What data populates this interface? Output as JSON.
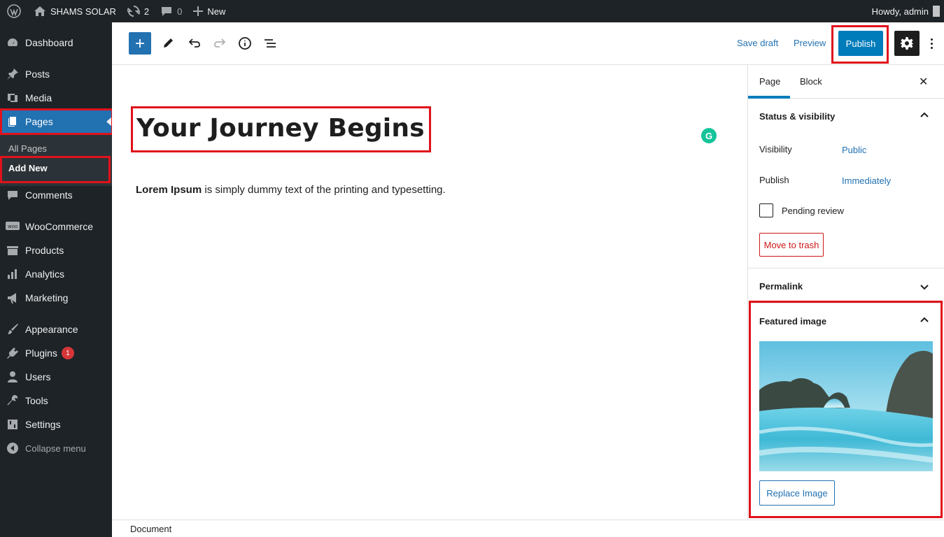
{
  "adminbar": {
    "site_name": "SHAMS SOLAR",
    "updates_count": "2",
    "comments_count": "0",
    "new_label": "New",
    "greeting": "Howdy, admin"
  },
  "sidebar": {
    "items": [
      {
        "label": "Dashboard"
      },
      {
        "label": "Posts"
      },
      {
        "label": "Media"
      },
      {
        "label": "Pages"
      },
      {
        "label": "Comments"
      },
      {
        "label": "WooCommerce"
      },
      {
        "label": "Products"
      },
      {
        "label": "Analytics"
      },
      {
        "label": "Marketing"
      },
      {
        "label": "Appearance"
      },
      {
        "label": "Plugins",
        "badge": "1"
      },
      {
        "label": "Users"
      },
      {
        "label": "Tools"
      },
      {
        "label": "Settings"
      }
    ],
    "submenu": {
      "all_pages": "All Pages",
      "add_new": "Add New"
    },
    "collapse_label": "Collapse menu",
    "active_color": "#2271b1"
  },
  "toolbar": {
    "save_draft": "Save draft",
    "preview": "Preview",
    "publish": "Publish"
  },
  "editor": {
    "title": "Your Journey Begins",
    "paragraph_bold": "Lorem Ipsum",
    "paragraph_rest": " is simply dummy text of the printing and typesetting.",
    "grammarly_glyph": "G"
  },
  "settings_panel": {
    "tabs": [
      "Page",
      "Block"
    ],
    "status_title": "Status & visibility",
    "visibility_label": "Visibility",
    "visibility_value": "Public",
    "publish_label": "Publish",
    "publish_value": "Immediately",
    "pending_review": "Pending review",
    "move_to_trash": "Move to trash",
    "permalink_title": "Permalink",
    "featured_title": "Featured image",
    "replace_image": "Replace Image"
  },
  "footer": {
    "breadcrumb": "Document"
  },
  "colors": {
    "highlight": "#e0121b",
    "admin_bg": "#1d2327",
    "accent": "#007cba"
  }
}
